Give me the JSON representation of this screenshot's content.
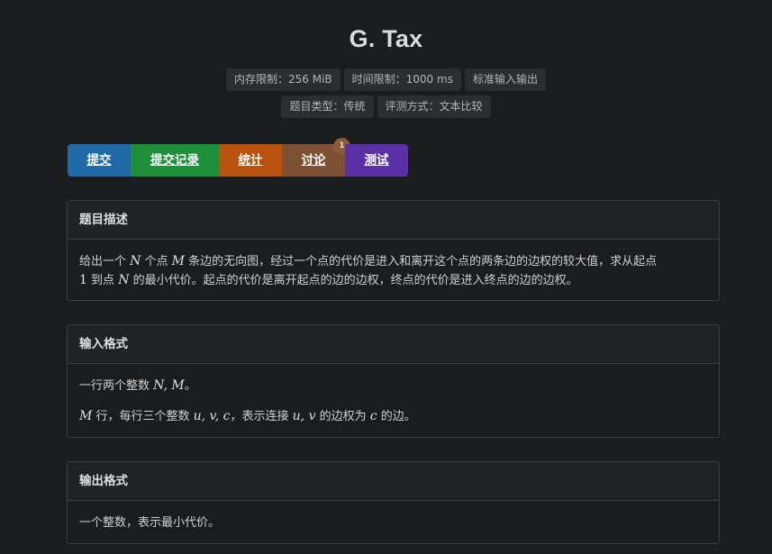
{
  "problem": {
    "title": "G. Tax"
  },
  "tags": {
    "row1": [
      "内存限制：256 MiB",
      "时间限制：1000 ms",
      "标准输入输出"
    ],
    "row2": [
      "题目类型：传统",
      "评测方式：文本比较"
    ]
  },
  "actions": {
    "submit": "提交",
    "records": "提交记录",
    "stats": "统计",
    "discuss": "讨论",
    "discuss_badge": "1",
    "test": "测试"
  },
  "description": {
    "heading": "题目描述",
    "p1_t1": "给出一个 ",
    "var_n": "N",
    "p1_t2": " 个点 ",
    "var_m": "M",
    "p1_t3": " 条边的无向图，经过一个点的代价是进入和离开这个点的两条边的边权的较大值，求从起点",
    "num_one": "1",
    "p1_t4": " 到点 ",
    "p1_t5": " 的最小代价。起点的代价是离开起点的边的边权，终点的代价是进入终点的边的边权。"
  },
  "input_format": {
    "heading": "输入格式",
    "l1_t1": "一行两个整数 ",
    "l1_math": "N, M",
    "l1_t2": "。",
    "l2_math1": "M",
    "l2_t1": " 行，每行三个整数 ",
    "l2_math2": "u, v, c",
    "l2_t2": "，表示连接 ",
    "l2_math3": "u, v",
    "l2_t3": " 的边权为 ",
    "l2_math4": "c",
    "l2_t4": " 的边。"
  },
  "output_format": {
    "heading": "输出格式",
    "l1": "一个整数，表示最小代价。"
  }
}
